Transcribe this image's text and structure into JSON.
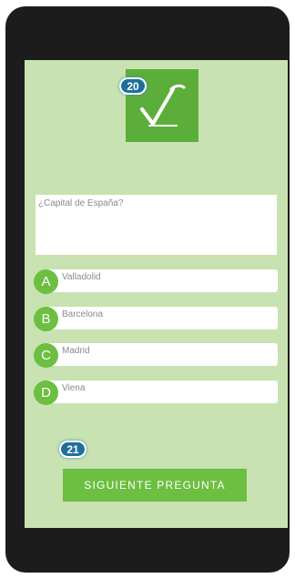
{
  "quiz": {
    "current_question_number": "20",
    "next_question_number": "21",
    "question_text": "¿Capital de España?",
    "answers": [
      {
        "letter": "A",
        "text": "Valladolid"
      },
      {
        "letter": "B",
        "text": "Barcelona"
      },
      {
        "letter": "C",
        "text": "Madrid"
      },
      {
        "letter": "D",
        "text": "Viena"
      }
    ],
    "next_button_label": "SIGUIENTE PREGUNTA"
  },
  "colors": {
    "screen_background": "#c9e2b1",
    "accent_green": "#6cbf40",
    "logo_green": "#5cae3a",
    "badge_blue": "#1f6f9c",
    "device_frame": "#1c1c1c"
  },
  "icons": {
    "logo": "checkmark-logo-icon"
  }
}
